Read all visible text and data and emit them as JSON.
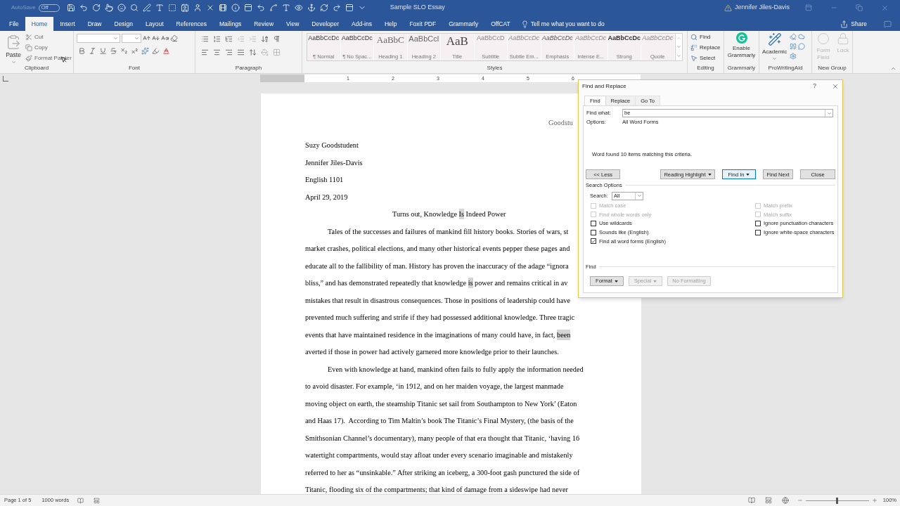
{
  "title_bar": {
    "autosave": {
      "label": "AutoSave",
      "on": false,
      "state_text": "Off"
    },
    "title": "Sample SLO Essay",
    "user": "Jennifer Jiles-Davis"
  },
  "tabs": [
    {
      "label": "File",
      "selected": false
    },
    {
      "label": "Home",
      "selected": true
    },
    {
      "label": "Insert",
      "selected": false
    },
    {
      "label": "Draw",
      "selected": false
    },
    {
      "label": "Design",
      "selected": false
    },
    {
      "label": "Layout",
      "selected": false
    },
    {
      "label": "References",
      "selected": false
    },
    {
      "label": "Mailings",
      "selected": false
    },
    {
      "label": "Review",
      "selected": false
    },
    {
      "label": "View",
      "selected": false
    },
    {
      "label": "Developer",
      "selected": false
    },
    {
      "label": "Add-ins",
      "selected": false
    },
    {
      "label": "Help",
      "selected": false
    },
    {
      "label": "Foxit PDF",
      "selected": false
    },
    {
      "label": "Grammarly",
      "selected": false
    },
    {
      "label": "OffCAT",
      "selected": false
    }
  ],
  "tell_me": "Tell me what you want to do",
  "share": "Share",
  "ribbon": {
    "clipboard": {
      "label": "Clipboard",
      "paste": "Paste",
      "items": [
        {
          "label": "Cut",
          "disabled": true
        },
        {
          "label": "Copy",
          "disabled": true
        },
        {
          "label": "Format Painter",
          "disabled": true
        }
      ]
    },
    "font": {
      "label": "Font"
    },
    "paragraph": {
      "label": "Paragraph"
    },
    "styles": {
      "label": "Styles",
      "items": [
        {
          "preview": "AaBbCcDc",
          "name": "¶ Normal",
          "kind": "normal"
        },
        {
          "preview": "AaBbCcDc",
          "name": "¶ No Spac...",
          "kind": "normal"
        },
        {
          "preview": "AaBbC",
          "name": "Heading 1",
          "kind": "heading"
        },
        {
          "preview": "AaBbCcl",
          "name": "Heading 2",
          "kind": "heading2"
        },
        {
          "preview": "AaB",
          "name": "Title",
          "kind": "title"
        },
        {
          "preview": "AaBbCcD",
          "name": "Subtitle",
          "kind": "subtitle"
        },
        {
          "preview": "AaBbCcDc",
          "name": "Subtle Em...",
          "kind": "subtle"
        },
        {
          "preview": "AaBbCcDc",
          "name": "Emphasis",
          "kind": "italic"
        },
        {
          "preview": "AaBbCcDc",
          "name": "Intense E...",
          "kind": "subtle"
        },
        {
          "preview": "AaBbCcDc",
          "name": "Strong",
          "kind": "bold"
        },
        {
          "preview": "AaBbCcDc",
          "name": "Quote",
          "kind": "subtle"
        }
      ]
    },
    "editing": {
      "label": "Editing",
      "items": [
        {
          "label": "Find"
        },
        {
          "label": "Replace"
        },
        {
          "label": "Select"
        }
      ]
    },
    "grammarly": {
      "label": "Grammarly",
      "button": "Enable Grammarly"
    },
    "prowritingaid": {
      "label": "ProWritingAid",
      "button": "Academic"
    },
    "new_group": {
      "label": "New Group",
      "items": [
        {
          "label": "Form Field",
          "disabled": true
        },
        {
          "label": "Lock",
          "disabled": true
        }
      ]
    }
  },
  "ruler": {
    "numbers": [
      "1",
      "2",
      "3",
      "4",
      "5",
      "6"
    ]
  },
  "document": {
    "header": "Goodstu",
    "lines": [
      {
        "kind": "plain",
        "segments": [
          {
            "text": "Suzy Goodstudent",
            "hit": false
          }
        ]
      },
      {
        "kind": "plain",
        "segments": [
          {
            "text": "Jennifer Jiles-Davis",
            "hit": false
          }
        ]
      },
      {
        "kind": "plain",
        "segments": [
          {
            "text": "English 1101",
            "hit": false
          }
        ]
      },
      {
        "kind": "plain",
        "segments": [
          {
            "text": "April 29, 2019",
            "hit": false
          }
        ]
      },
      {
        "kind": "title",
        "segments": [
          {
            "text": "Turns out, Knowledge ",
            "hit": false
          },
          {
            "text": "Is",
            "hit": true
          },
          {
            "text": " Indeed Power",
            "hit": false
          }
        ]
      },
      {
        "kind": "first",
        "segments": [
          {
            "text": "Tales of the successes and failures of mankind fill history books. Stories of wars, st",
            "hit": false
          }
        ]
      },
      {
        "kind": "body",
        "segments": [
          {
            "text": "market crashes, political elections, and many other historical events pepper these pages and",
            "hit": false
          }
        ]
      },
      {
        "kind": "body",
        "segments": [
          {
            "text": "educate all to the fallibility of man. History has proven the inaccuracy of the adage “ignora",
            "hit": false
          }
        ]
      },
      {
        "kind": "body",
        "segments": [
          {
            "text": "bliss,” and has demonstrated repeatedly that knowledge ",
            "hit": false
          },
          {
            "text": "is",
            "hit": true
          },
          {
            "text": " power and remains critical in av",
            "hit": false
          }
        ]
      },
      {
        "kind": "body",
        "segments": [
          {
            "text": "mistakes that result in disastrous consequences. Those in positions of leadership could have",
            "hit": false
          }
        ]
      },
      {
        "kind": "body",
        "segments": [
          {
            "text": "prevented much suffering and strife if they had possessed additional knowledge. Three tragic",
            "hit": false
          }
        ]
      },
      {
        "kind": "body",
        "segments": [
          {
            "text": "events that have maintained residence in the imaginations of many could have, in fact, ",
            "hit": false
          },
          {
            "text": "been",
            "hit": true
          }
        ]
      },
      {
        "kind": "body",
        "segments": [
          {
            "text": "averted if those in power had actively garnered more knowledge prior to their launches.",
            "hit": false
          }
        ]
      },
      {
        "kind": "first",
        "segments": [
          {
            "text": "Even with knowledge at hand, mankind often fails to fully apply the information needed",
            "hit": false
          }
        ]
      },
      {
        "kind": "body",
        "segments": [
          {
            "text": "to avoid disaster. For example, ‘in 1912, and on her maiden voyage, the largest manmade",
            "hit": false
          }
        ]
      },
      {
        "kind": "body",
        "segments": [
          {
            "text": "moving object on earth, the steamship Titanic set sail from Southampton to New York’ (Eaton",
            "hit": false
          }
        ]
      },
      {
        "kind": "body",
        "segments": [
          {
            "text": "and Haas 17).  According to Tim Maltin’s book The Titanic’s Final Mystery, (the basis of the",
            "hit": false
          }
        ]
      },
      {
        "kind": "body",
        "segments": [
          {
            "text": "Smithsonian Channel’s documentary), many people of that era thought that Titanic, ‘having 16",
            "hit": false
          }
        ]
      },
      {
        "kind": "body",
        "segments": [
          {
            "text": "watertight compartments, would stay afloat under every scenario imaginable and mistakenly",
            "hit": false
          }
        ]
      },
      {
        "kind": "body",
        "segments": [
          {
            "text": "referred to her as “unsinkable.” After striking an iceberg, a 300-foot gash punctured the side of",
            "hit": false
          }
        ]
      },
      {
        "kind": "body",
        "segments": [
          {
            "text": "Titanic, flooding six of the compartments; that kind of damage from a sideswipe had never",
            "hit": false
          }
        ]
      }
    ]
  },
  "dialog": {
    "title": "Find and Replace",
    "help": "?",
    "tabs": [
      {
        "label": "Find",
        "selected": true
      },
      {
        "label": "Replace",
        "selected": false
      },
      {
        "label": "Go To",
        "selected": false
      }
    ],
    "find_what": {
      "label": "Find what:",
      "value": "be"
    },
    "options": {
      "label": "Options:",
      "value": "All Word Forms"
    },
    "message": "Word found 10 items matching this criteria.",
    "buttons": [
      {
        "label": "<< Less",
        "dropdown": false,
        "focused": false
      },
      {
        "label": "Reading Highlight",
        "dropdown": true,
        "focused": false
      },
      {
        "label": "Find In",
        "dropdown": true,
        "focused": true
      },
      {
        "label": "Find Next",
        "dropdown": false,
        "focused": false
      },
      {
        "label": "Close",
        "dropdown": false,
        "focused": false
      }
    ],
    "search_options": {
      "label": "Search Options",
      "search_label": "Search:",
      "search_value": "All",
      "left": [
        {
          "label": "Match case",
          "checked": false,
          "disabled": true
        },
        {
          "label": "Find whole words only",
          "checked": false,
          "disabled": true
        },
        {
          "label": "Use wildcards",
          "checked": false,
          "disabled": false
        },
        {
          "label": "Sounds like (English)",
          "checked": false,
          "disabled": false
        },
        {
          "label": "Find all word forms (English)",
          "checked": true,
          "disabled": false
        }
      ],
      "right": [
        {
          "label": "Match prefix",
          "checked": false,
          "disabled": true
        },
        {
          "label": "Match suffix",
          "checked": false,
          "disabled": true
        },
        {
          "label": "Ignore punctuation characters",
          "checked": false,
          "disabled": false
        },
        {
          "label": "Ignore white-space characters",
          "checked": false,
          "disabled": false
        }
      ]
    },
    "find_section": {
      "label": "Find",
      "buttons": [
        {
          "label": "Format",
          "dropdown": true,
          "disabled": false
        },
        {
          "label": "Special",
          "dropdown": true,
          "disabled": true
        },
        {
          "label": "No Formatting",
          "dropdown": false,
          "disabled": true
        }
      ]
    }
  },
  "status_bar": {
    "page": "Page 1 of 5",
    "words": "1000 words",
    "zoom": {
      "level": 0.5,
      "reading": "100%"
    }
  }
}
